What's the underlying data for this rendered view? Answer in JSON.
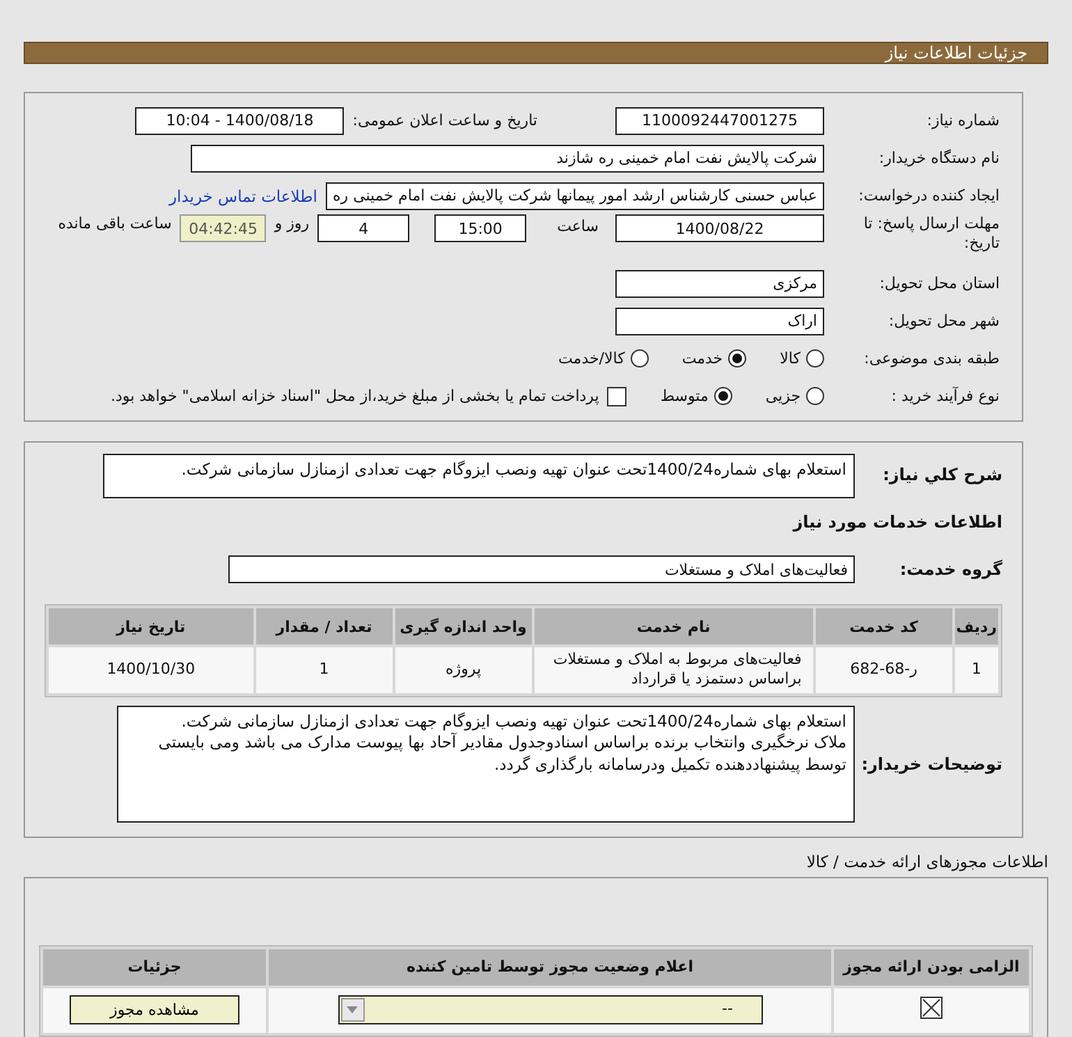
{
  "header": {
    "title": "جزئیات اطلاعات نیاز"
  },
  "details": {
    "need_number": {
      "label": "شماره نیاز:",
      "value": "1100092447001275"
    },
    "announce": {
      "label": "تاریخ و ساعت اعلان عمومی:",
      "value": "1400/08/18 - 10:04"
    },
    "buyer": {
      "label": "نام دستگاه خریدار:",
      "value": "شرکت پالایش نفت امام خمینی  ره  شازند"
    },
    "requester": {
      "label": "ایجاد کننده درخواست:",
      "value": "عباس حسنی کارشناس ارشد امور پیمانها شرکت پالایش نفت امام خمینی  ره",
      "link": "اطلاعات تماس خریدار"
    },
    "deadline": {
      "label": "مهلت ارسال پاسخ: تا تاریخ:",
      "date": "1400/08/22",
      "time_label": "ساعت",
      "time": "15:00",
      "days": "4",
      "days_label": "روز و",
      "remaining": "04:42:45",
      "remaining_label": "ساعت باقی مانده"
    },
    "province": {
      "label": "استان محل تحویل:",
      "value": "مرکزی"
    },
    "city": {
      "label": "شهر محل تحویل:",
      "value": "اراک"
    },
    "category": {
      "label": "طبقه بندی موضوعی:",
      "options": [
        {
          "label": "کالا",
          "selected": false
        },
        {
          "label": "خدمت",
          "selected": true
        },
        {
          "label": "کالا/خدمت",
          "selected": false
        }
      ]
    },
    "process": {
      "label": "نوع فرآیند خرید :",
      "options": [
        {
          "label": "جزیی",
          "selected": false
        },
        {
          "label": "متوسط",
          "selected": true
        }
      ],
      "payment": {
        "label": "پرداخت تمام یا بخشی از مبلغ خرید،از محل \"اسناد خزانه اسلامی\" خواهد بود.",
        "checked": false
      }
    }
  },
  "services": {
    "summary": {
      "label": "شرح کلي نياز:",
      "value": "استعلام بهای شماره1400/24تحت عنوان تهیه ونصب ایزوگام جهت تعدادی ازمنازل سازمانی شرکت."
    },
    "section_title": "اطلاعات خدمات مورد نیاز",
    "group": {
      "label": "گروه خدمت:",
      "value": "فعالیت‌های  املاک و مستغلات"
    },
    "table": {
      "columns": [
        "ردیف",
        "کد خدمت",
        "نام خدمت",
        "واحد اندازه گیری",
        "تعداد / مقدار",
        "تاریخ نیاز"
      ],
      "rows": [
        [
          "1",
          "ر-68-682",
          "فعالیت‌های مربوط به املاک و مستغلات براساس دستمزد یا قرارداد",
          "پروژه",
          "1",
          "1400/10/30"
        ]
      ]
    },
    "notes": {
      "label": "توضیحات خریدار:",
      "value": "استعلام بهای شماره1400/24تحت عنوان تهیه ونصب ایزوگام جهت تعدادی ازمنازل سازمانی شرکت.\nملاک نرخگیری وانتخاب برنده براساس اسنادوجدول مقادیر آحاد بها پیوست مدارک می باشد ومی بایستی توسط پیشنهاددهنده تکمیل ودرسامانه بارگذاری گردد."
    }
  },
  "permits": {
    "title": "اطلاعات مجوزهای ارائه خدمت / کالا",
    "columns": [
      "الزامی بودن ارائه مجوز",
      "اعلام وضعیت مجوز توسط تامین کننده",
      "جزئیات"
    ],
    "rows": [
      {
        "required": true,
        "status": "--",
        "button": "مشاهده مجوز"
      }
    ]
  }
}
